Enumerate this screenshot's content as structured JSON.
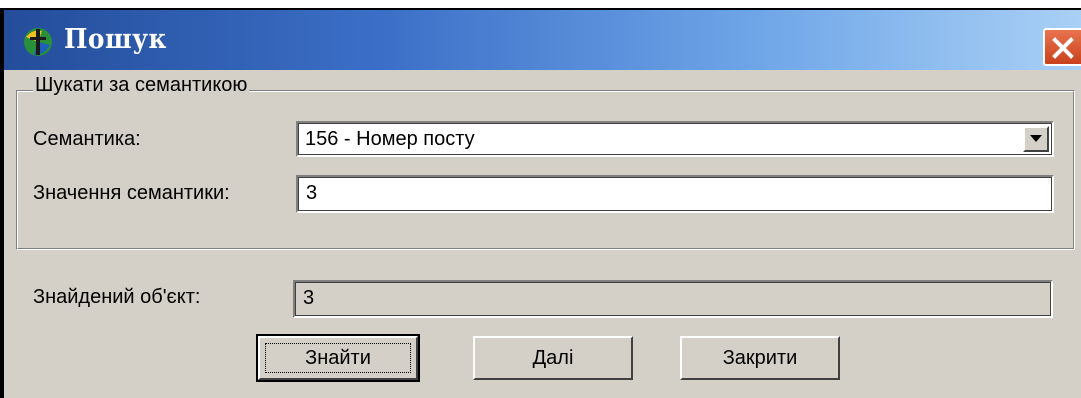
{
  "window": {
    "title": "Пошук",
    "icon": "app-map-icon",
    "close_icon": "close-icon"
  },
  "group": {
    "legend": "Шукати за семантикою",
    "semantic_label": "Семантика:",
    "semantic_selected": "156 - Номер посту",
    "value_label": "Значення семантики:",
    "value": "3"
  },
  "result": {
    "label": "Знайдений об'єкт:",
    "value": "3"
  },
  "buttons": {
    "find": "Знайти",
    "next": "Далі",
    "close": "Закрити"
  },
  "colors": {
    "face": "#d4d0c8",
    "title_start": "#244d9a",
    "title_end": "#a9d0f5",
    "close_button": "#d9572f"
  }
}
